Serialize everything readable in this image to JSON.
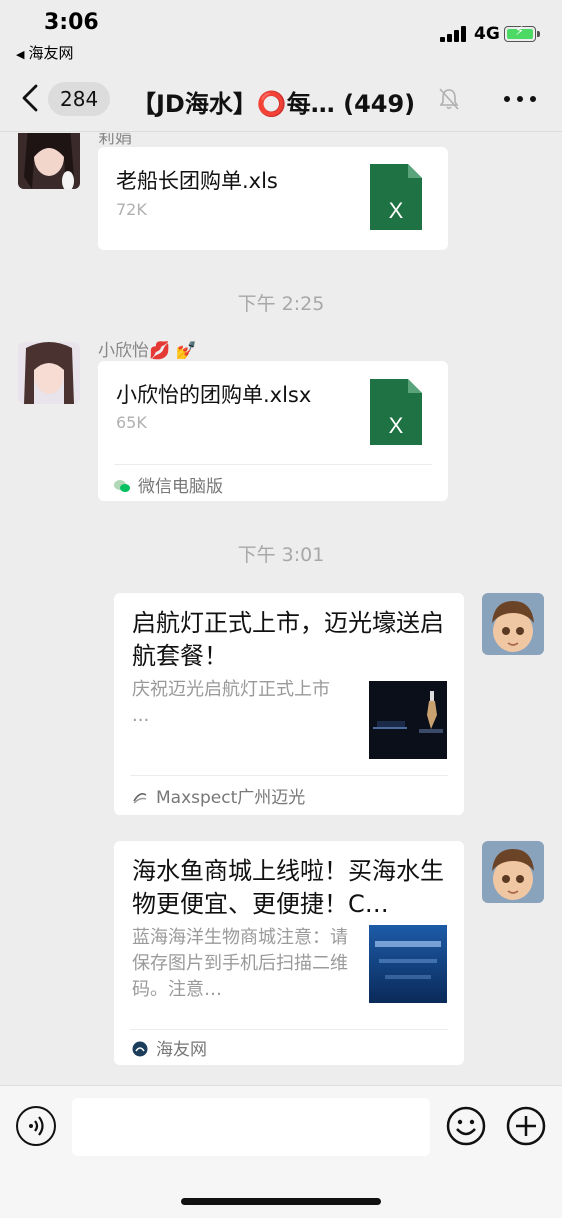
{
  "status_bar": {
    "time": "3:06",
    "back_app": "海友网",
    "network": "4G"
  },
  "nav": {
    "unread_count": "284",
    "title": "【JD海水】⭕每…",
    "member_count": "(449)"
  },
  "messages": [
    {
      "sender": "莉娟",
      "file_name": "老船长团购单.xls",
      "file_size": "72K"
    },
    {
      "timestamp": "下午 2:25"
    },
    {
      "sender": "小欣怡💋 💅",
      "file_name": "小欣怡的团购单.xlsx",
      "file_size": "65K",
      "source": "微信电脑版"
    },
    {
      "timestamp": "下午 3:01"
    },
    {
      "title": "启航灯正式上市，迈光壕送启航套餐！",
      "description": "庆祝迈光启航灯正式上市\n...",
      "source": "Maxspect广州迈光"
    },
    {
      "title": "海水鱼商城上线啦！买海水生物更便宜、更便捷！C…",
      "description": "蓝海海洋生物商城注意：请保存图片到手机后扫描二维码。注意…",
      "source": "海友网"
    }
  ],
  "input": {
    "placeholder": ""
  },
  "colors": {
    "background": "#ededed",
    "bubble": "#ffffff",
    "excel_green": "#1f7244",
    "wechat_green": "#07c160"
  },
  "icons": {
    "file": "excel-file-icon",
    "voice": "voice-icon",
    "emoji": "emoji-icon",
    "plus": "plus-icon",
    "mute": "mute-bell-icon",
    "more": "more-dots-icon",
    "back": "chevron-left-icon"
  }
}
